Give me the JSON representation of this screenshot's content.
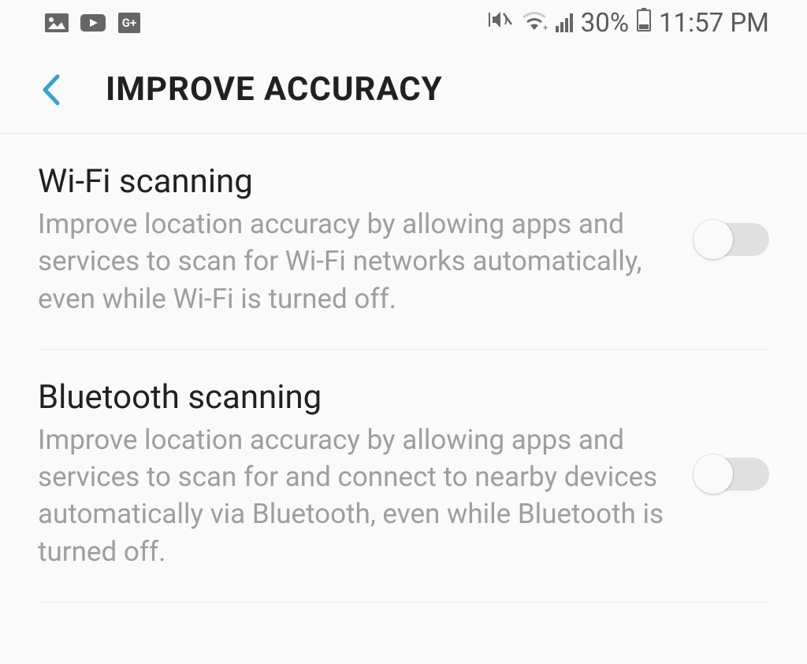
{
  "status": {
    "battery_percent": "30%",
    "time": "11:57 PM"
  },
  "header": {
    "title": "IMPROVE ACCURACY"
  },
  "settings": [
    {
      "title": "Wi-Fi scanning",
      "description": "Improve location accuracy by allowing apps and services to scan for Wi-Fi networks automatically, even while Wi-Fi is turned off.",
      "enabled": false
    },
    {
      "title": "Bluetooth scanning",
      "description": "Improve location accuracy by allowing apps and services to scan for and connect to nearby devices automatically via Bluetooth, even while Bluetooth is turned off.",
      "enabled": false
    }
  ]
}
